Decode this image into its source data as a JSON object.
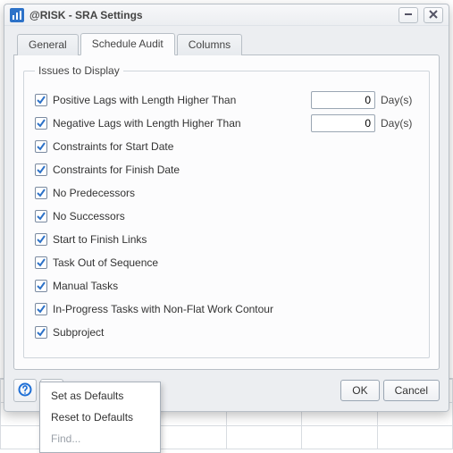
{
  "window": {
    "title": "@RISK - SRA Settings",
    "minimize_tooltip": "Minimize",
    "close_tooltip": "Close"
  },
  "tabs": [
    {
      "label": "General",
      "active": false
    },
    {
      "label": "Schedule Audit",
      "active": true
    },
    {
      "label": "Columns",
      "active": false
    }
  ],
  "group": {
    "legend": "Issues to Display"
  },
  "units": {
    "days": "Day(s)"
  },
  "rows": {
    "pos_lag": {
      "label": "Positive Lags with Length Higher Than",
      "value": "0",
      "checked": true,
      "hasInput": true
    },
    "neg_lag": {
      "label": "Negative Lags with Length Higher Than",
      "value": "0",
      "checked": true,
      "hasInput": true
    },
    "c_start": {
      "label": "Constraints for Start Date",
      "checked": true
    },
    "c_finish": {
      "label": "Constraints for Finish Date",
      "checked": true
    },
    "no_pred": {
      "label": "No Predecessors",
      "checked": true
    },
    "no_succ": {
      "label": "No Successors",
      "checked": true
    },
    "sf_links": {
      "label": "Start to Finish Links",
      "checked": true
    },
    "out_seq": {
      "label": "Task Out of Sequence",
      "checked": true
    },
    "manual": {
      "label": "Manual Tasks",
      "checked": true
    },
    "inprog": {
      "label": "In-Progress Tasks with Non-Flat Work Contour",
      "checked": true
    },
    "subproj": {
      "label": "Subproject",
      "checked": true
    }
  },
  "buttons": {
    "ok": "OK",
    "cancel": "Cancel"
  },
  "menu": {
    "set_defaults": "Set as Defaults",
    "reset_defaults": "Reset to Defaults",
    "find": "Find..."
  },
  "icons": {
    "app": "bar-chart-icon",
    "help": "help-icon",
    "gear": "gear-icon",
    "minimize": "minimize-icon",
    "close": "close-icon",
    "check": "check-icon"
  },
  "colors": {
    "check": "#2d72c8",
    "help_ring": "#1e6fd6"
  }
}
